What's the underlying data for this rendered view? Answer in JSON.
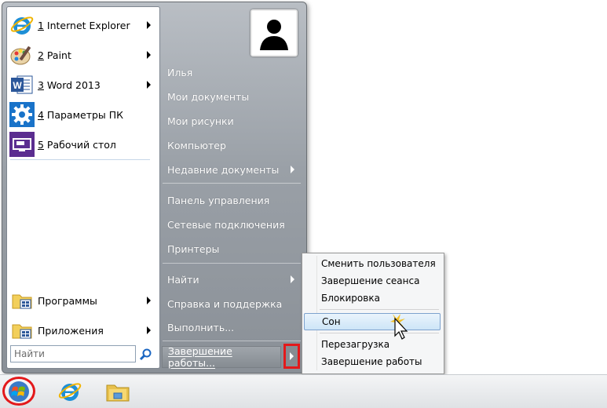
{
  "start_menu": {
    "pinned": [
      {
        "hotkey": "1",
        "label": " Internet Explorer",
        "icon": "internet-explorer-icon"
      },
      {
        "hotkey": "2",
        "label": " Paint",
        "icon": "paint-icon"
      },
      {
        "hotkey": "3",
        "label": " Word 2013",
        "icon": "word-icon"
      },
      {
        "hotkey": "4",
        "label": " Параметры ПК",
        "icon": "gear-icon"
      },
      {
        "hotkey": "5",
        "label": " Рабочий стол",
        "icon": "desktop-icon"
      }
    ],
    "bottom": [
      {
        "label": "Программы",
        "icon": "programs-folder-icon"
      },
      {
        "label": "Приложения",
        "icon": "apps-folder-icon"
      }
    ],
    "search": {
      "placeholder": "Найти",
      "icon": "search-icon"
    },
    "right_items": [
      {
        "label": "Илья"
      },
      {
        "label": "Мои документы"
      },
      {
        "label": "Мои рисунки"
      },
      {
        "label": "Компьютер"
      },
      {
        "label": "Недавние документы",
        "has_arrow": true
      },
      {
        "label": "Панель управления"
      },
      {
        "label": "Сетевые подключения"
      },
      {
        "label": "Принтеры"
      },
      {
        "label": "Найти",
        "has_arrow": true
      },
      {
        "label": "Справка и поддержка"
      },
      {
        "label": "Выполнить..."
      }
    ],
    "shutdown": {
      "label": "Завершение работы..."
    }
  },
  "power_submenu": {
    "items": [
      {
        "label": "Сменить пользователя"
      },
      {
        "label": "Завершение сеанса"
      },
      {
        "label": "Блокировка"
      },
      {
        "label": "Сон",
        "highlighted": true
      },
      {
        "label": "Перезагрузка"
      },
      {
        "label": "Завершение работы"
      }
    ]
  },
  "taskbar": {
    "items": [
      {
        "icon": "start-orb-icon"
      },
      {
        "icon": "internet-explorer-icon"
      },
      {
        "icon": "file-explorer-icon"
      }
    ]
  },
  "colors": {
    "highlight_red": "#e3191b",
    "menu_gray": "#9aa0a7",
    "ie_blue": "#1e8fd6"
  }
}
